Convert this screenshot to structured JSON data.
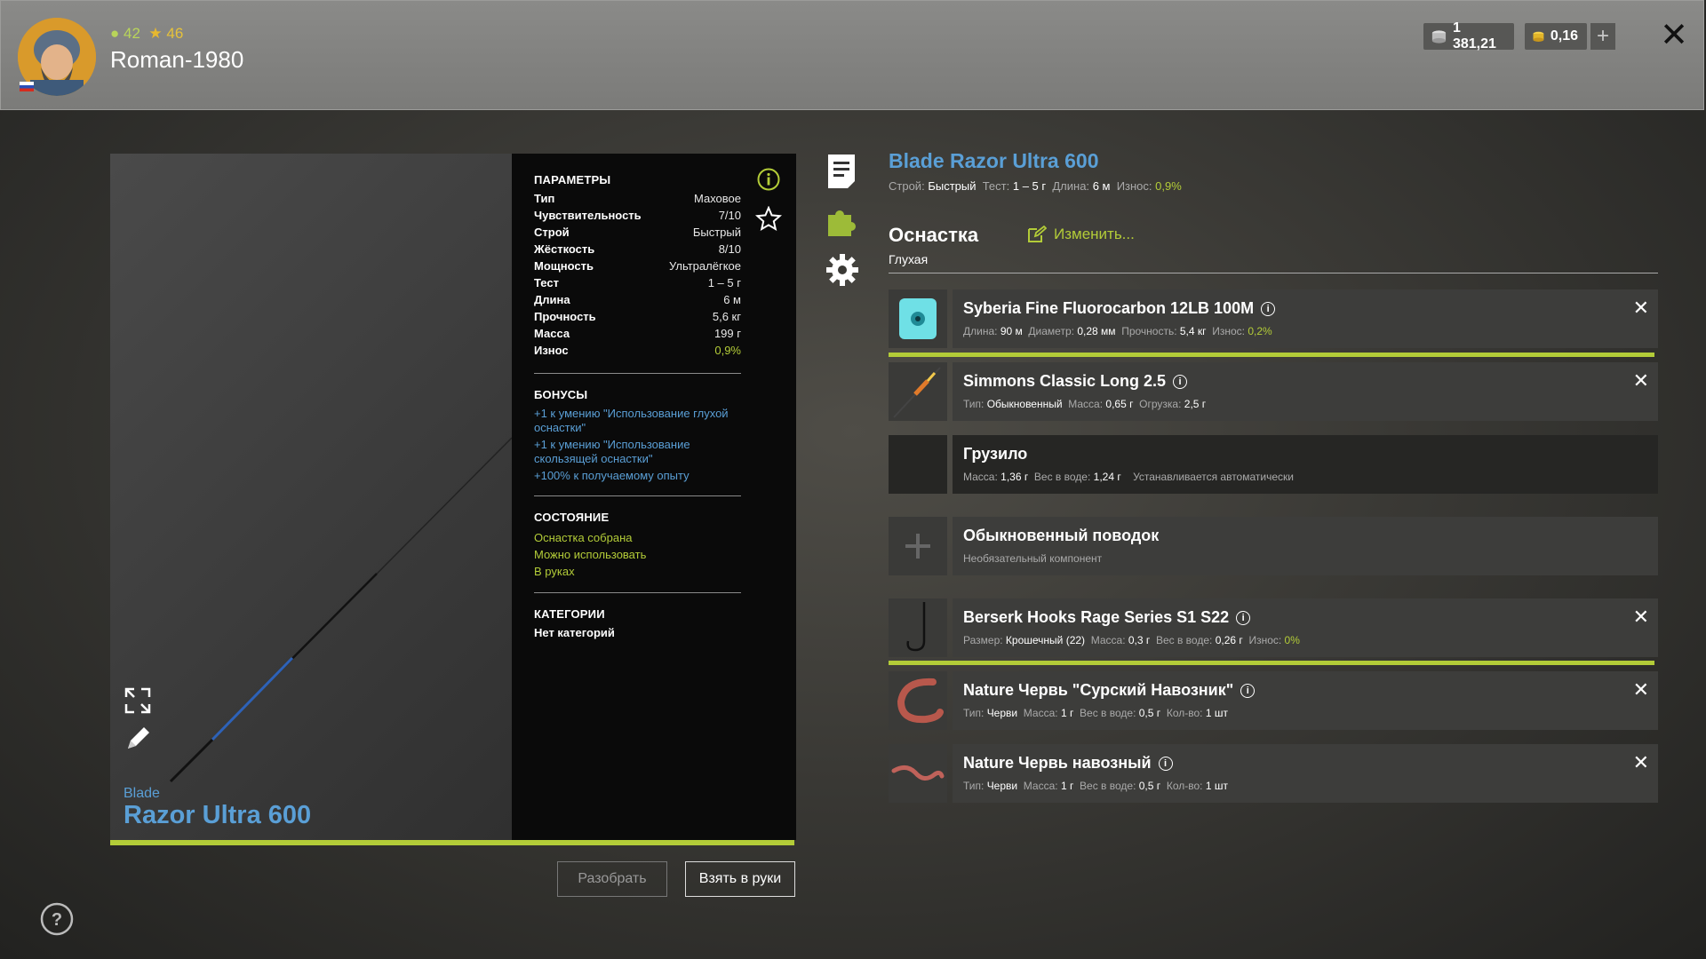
{
  "header": {
    "level": "42",
    "stars": "46",
    "username": "Roman-1980",
    "silver": "1 381,21",
    "gold": "0,16"
  },
  "rod": {
    "brand": "Blade",
    "name": "Razor Ultra 600"
  },
  "params": {
    "section_title": "ПАРАМЕТРЫ",
    "rows": [
      {
        "label": "Тип",
        "value": "Маховое"
      },
      {
        "label": "Чувствительность",
        "value": "7/10"
      },
      {
        "label": "Строй",
        "value": "Быстрый"
      },
      {
        "label": "Жёсткость",
        "value": "8/10"
      },
      {
        "label": "Мощность",
        "value": "Ультралёгкое"
      },
      {
        "label": "Тест",
        "value": "1 – 5 г"
      },
      {
        "label": "Длина",
        "value": "6 м"
      },
      {
        "label": "Прочность",
        "value": "5,6 кг"
      },
      {
        "label": "Масса",
        "value": "199 г"
      },
      {
        "label": "Износ",
        "value": "0,9%"
      }
    ],
    "bonuses_title": "БОНУСЫ",
    "bonuses": [
      "+1 к умению \"Использование глухой оснастки\"",
      "+1 к умению \"Использование скользящей оснастки\"",
      "+100% к получаемому опыту"
    ],
    "state_title": "СОСТОЯНИЕ",
    "states": [
      "Оснастка собрана",
      "Можно использовать",
      "В руках"
    ],
    "categories_title": "КАТЕГОРИИ",
    "categories": "Нет категорий"
  },
  "detail": {
    "title": "Blade Razor Ultra 600",
    "sub": {
      "stroy_label": "Строй:",
      "stroy": "Быстрый",
      "test_label": "Тест:",
      "test": "1 – 5 г",
      "len_label": "Длина:",
      "len": "6 м",
      "wear_label": "Износ:",
      "wear": "0,9%"
    },
    "tackle_title": "Оснастка",
    "tackle_type": "Глухая",
    "edit_label": "Изменить..."
  },
  "items": [
    {
      "title": "Syberia Fine Fluorocarbon 12LB 100M",
      "d": [
        [
          "Длина:",
          "90 м"
        ],
        [
          "Диаметр:",
          "0,28 мм"
        ],
        [
          "Прочность:",
          "5,4 кг"
        ],
        [
          "Износ:",
          "0,2%"
        ]
      ]
    },
    {
      "title": "Simmons Classic Long 2.5",
      "d": [
        [
          "Тип:",
          "Обыкновенный"
        ],
        [
          "Масса:",
          "0,65 г"
        ],
        [
          "Огрузка:",
          "2,5 г"
        ]
      ]
    },
    {
      "title": "Грузило",
      "d": [
        [
          "Масса:",
          "1,36 г"
        ],
        [
          "Вес в воде:",
          "1,24 г"
        ]
      ],
      "note": "Устанавливается автоматически"
    },
    {
      "title": "Обыкновенный поводок",
      "note": "Необязательный компонент"
    },
    {
      "title": "Berserk Hooks Rage Series S1 S22",
      "d": [
        [
          "Размер:",
          "Крошечный (22)"
        ],
        [
          "Масса:",
          "0,3 г"
        ],
        [
          "Вес в воде:",
          "0,26 г"
        ],
        [
          "Износ:",
          "0%"
        ]
      ]
    },
    {
      "title": "Nature Червь \"Сурский Навозник\"",
      "d": [
        [
          "Тип:",
          "Черви"
        ],
        [
          "Масса:",
          "1 г"
        ],
        [
          "Вес в воде:",
          "0,5 г"
        ],
        [
          "Кол-во:",
          "1 шт"
        ]
      ]
    },
    {
      "title": "Nature Червь навозный",
      "d": [
        [
          "Тип:",
          "Черви"
        ],
        [
          "Масса:",
          "1 г"
        ],
        [
          "Вес в воде:",
          "0,5 г"
        ],
        [
          "Кол-во:",
          "1 шт"
        ]
      ]
    }
  ],
  "buttons": {
    "disassemble": "Разобрать",
    "take": "Взять в руки"
  },
  "colors": {
    "accent_green": "#b3cc38",
    "accent_blue": "#5a9fd6"
  }
}
